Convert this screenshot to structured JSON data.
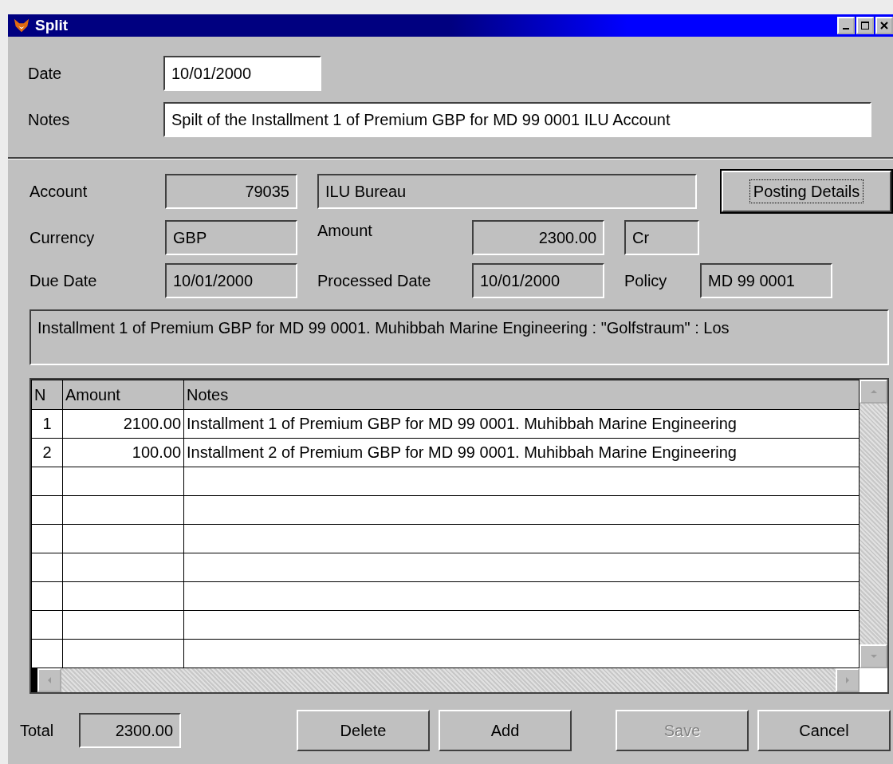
{
  "window": {
    "title": "Split"
  },
  "date": {
    "label": "Date",
    "value": "10/01/2000"
  },
  "notes": {
    "label": "Notes",
    "value": "Spilt of the Installment 1 of Premium GBP for MD 99 0001 ILU Account"
  },
  "account": {
    "label": "Account",
    "number": "79035",
    "name": "ILU Bureau"
  },
  "posting_button": "Posting Details",
  "currency": {
    "label": "Currency",
    "value": "GBP"
  },
  "amount": {
    "label": "Amount",
    "value": "2300.00",
    "type": "Cr"
  },
  "due_date": {
    "label": "Due Date",
    "value": "10/01/2000"
  },
  "processed_date": {
    "label": "Processed Date",
    "value": "10/01/2000"
  },
  "policy": {
    "label": "Policy",
    "value": "MD 99 0001"
  },
  "description": "Installment 1 of Premium GBP for MD 99 0001. Muhibbah Marine Engineering : \"Golfstraum\" : Los",
  "table": {
    "columns": [
      "N",
      "Amount",
      "Notes"
    ],
    "rows": [
      {
        "n": "1",
        "amount": "2100.00",
        "notes": "Installment 1 of Premium GBP for MD 99 0001. Muhibbah Marine Engineering"
      },
      {
        "n": "2",
        "amount": "100.00",
        "notes": "Installment 2 of Premium GBP for MD 99 0001. Muhibbah Marine Engineering"
      }
    ]
  },
  "total": {
    "label": "Total",
    "value": "2300.00"
  },
  "buttons": [
    {
      "label": "Delete",
      "disabled": false
    },
    {
      "label": "Add",
      "disabled": false
    },
    {
      "label": "Save",
      "disabled": true
    },
    {
      "label": "Cancel",
      "disabled": false
    }
  ]
}
